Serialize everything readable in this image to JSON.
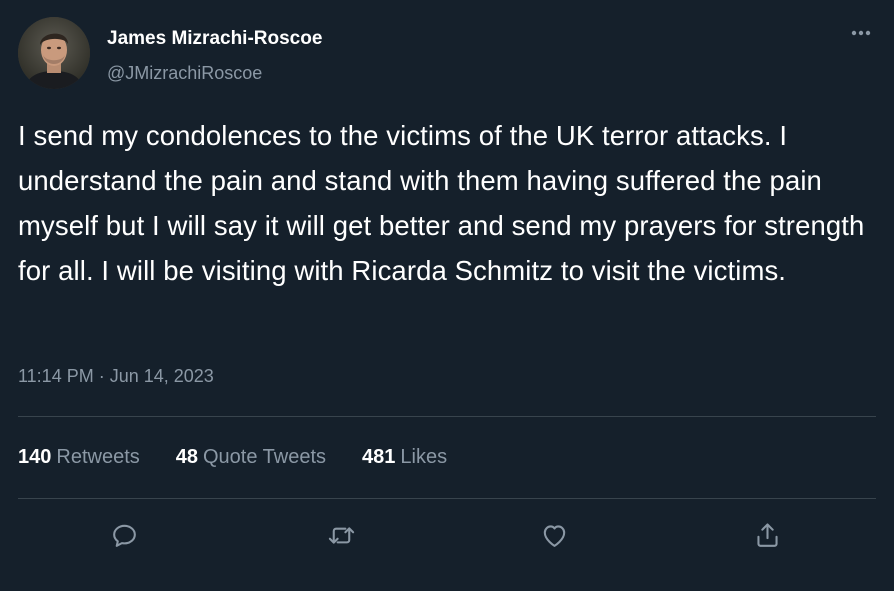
{
  "author": {
    "name": "James Mizrachi-Roscoe",
    "handle": "@JMizrachiRoscoe"
  },
  "tweet": {
    "text": "I send my condolences to the victims of the UK terror attacks. I understand the pain and stand with them having suffered the pain myself but I will say it will get better and send my prayers for strength for all. I will be visiting with Ricarda Schmitz to visit the victims.",
    "timestamp": "11:14 PM · Jun 14, 2023"
  },
  "stats": {
    "retweets": {
      "count": "140",
      "label": "Retweets"
    },
    "quote_tweets": {
      "count": "48",
      "label": "Quote Tweets"
    },
    "likes": {
      "count": "481",
      "label": "Likes"
    }
  },
  "actions": [
    "reply-icon",
    "retweet-icon",
    "like-icon",
    "share-icon"
  ],
  "colors": {
    "background": "#15202b",
    "primary_text": "#ffffff",
    "secondary_text": "#8b98a5",
    "divider": "#38444d"
  }
}
